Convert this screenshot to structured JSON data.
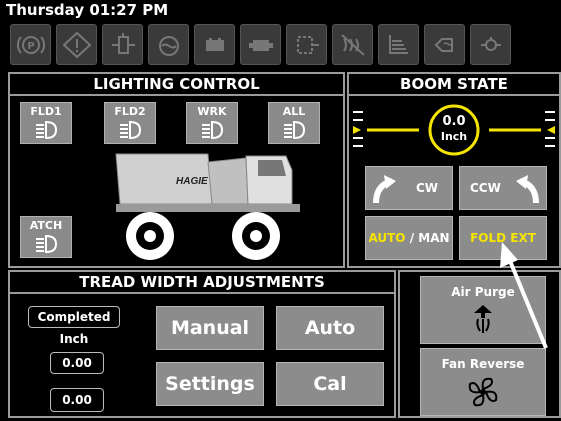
{
  "status_bar": {
    "clock": "Thursday 01:27 PM"
  },
  "warning_icons": [
    "parking-brake-icon",
    "warning-diamond-icon",
    "fuel-filter-icon",
    "engine-coolant-icon",
    "battery-charge-icon",
    "engine-icon",
    "air-filter-icon",
    "no-regen-icon",
    "hydraulic-level-icon",
    "hydraulic-temp-icon",
    "oil-pressure-icon"
  ],
  "lighting_control": {
    "title": "LIGHTING CONTROL",
    "buttons": [
      {
        "label": "FLD1",
        "icon": "headlight-icon"
      },
      {
        "label": "FLD2",
        "icon": "headlight-icon"
      },
      {
        "label": "WRK",
        "icon": "headlight-icon"
      },
      {
        "label": "ALL",
        "icon": "headlight-icon"
      },
      {
        "label": "ATCH",
        "icon": "headlight-icon"
      }
    ],
    "vehicle_brand": "HAGIE"
  },
  "boom_state": {
    "title": "BOOM STATE",
    "value": "0.0",
    "unit": "Inch",
    "cw_label": "CW",
    "ccw_label": "CCW",
    "auto_label": "AUTO",
    "slash": " / ",
    "man_label": "MAN",
    "fold_ext_label": "FOLD EXT",
    "accent_color": "#f5e400"
  },
  "tread_width": {
    "title": "TREAD WIDTH ADJUSTMENTS",
    "status": "Completed",
    "unit": "Inch",
    "value_1": "0.00",
    "value_2": "0.00",
    "manual_label": "Manual",
    "auto_label": "Auto",
    "settings_label": "Settings",
    "cal_label": "Cal"
  },
  "air_purge": {
    "label": "Air Purge"
  },
  "fan_reverse": {
    "label": "Fan Reverse"
  }
}
